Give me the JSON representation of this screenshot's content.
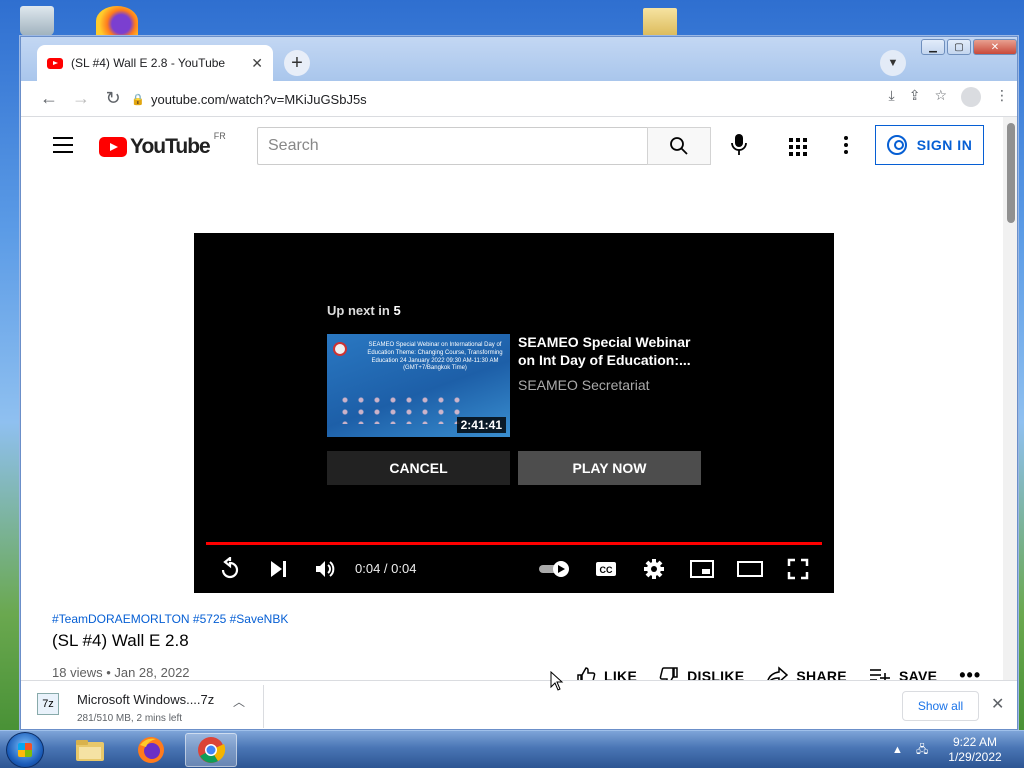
{
  "browser": {
    "tab_title": "(SL #4) Wall E 2.8 - YouTube",
    "tab_close": "✕",
    "new_tab": "+",
    "url": "youtube.com/watch?v=MKiJuGSbJ5s",
    "window_controls": {
      "minimize": "▁",
      "maximize": "▢",
      "close": "✕"
    }
  },
  "youtube": {
    "logo_text": "YouTube",
    "country_code": "FR",
    "search_placeholder": "Search",
    "sign_in_label": "SIGN IN"
  },
  "player": {
    "upnext_prefix": "Up next in",
    "upnext_count": "5",
    "next_video": {
      "title": "SEAMEO Special Webinar on Int Day of Education:...",
      "channel": "SEAMEO Secretariat",
      "duration": "2:41:41",
      "thumbnail_text": "SEAMEO Special Webinar on International Day of Education Theme: Changing Course, Transforming Education 24 January 2022 09:30 AM-11:30 AM (GMT+7/Bangkok Time)"
    },
    "cancel_label": "CANCEL",
    "play_now_label": "PLAY NOW",
    "time": "0:04 / 0:04",
    "progress": 1.0
  },
  "video": {
    "hashtags": "#TeamDORAEMORLTON #5725 #SaveNBK",
    "title": "(SL #4) Wall E 2.8",
    "views_date": "18 views • Jan 28, 2022",
    "actions": {
      "like": "LIKE",
      "dislike": "DISLIKE",
      "share": "SHARE",
      "save": "SAVE"
    }
  },
  "download": {
    "name": "Microsoft Windows....7z",
    "status": "281/510 MB, 2 mins left",
    "show_all": "Show all"
  },
  "taskbar": {
    "time": "9:22 AM",
    "date": "1/29/2022"
  }
}
